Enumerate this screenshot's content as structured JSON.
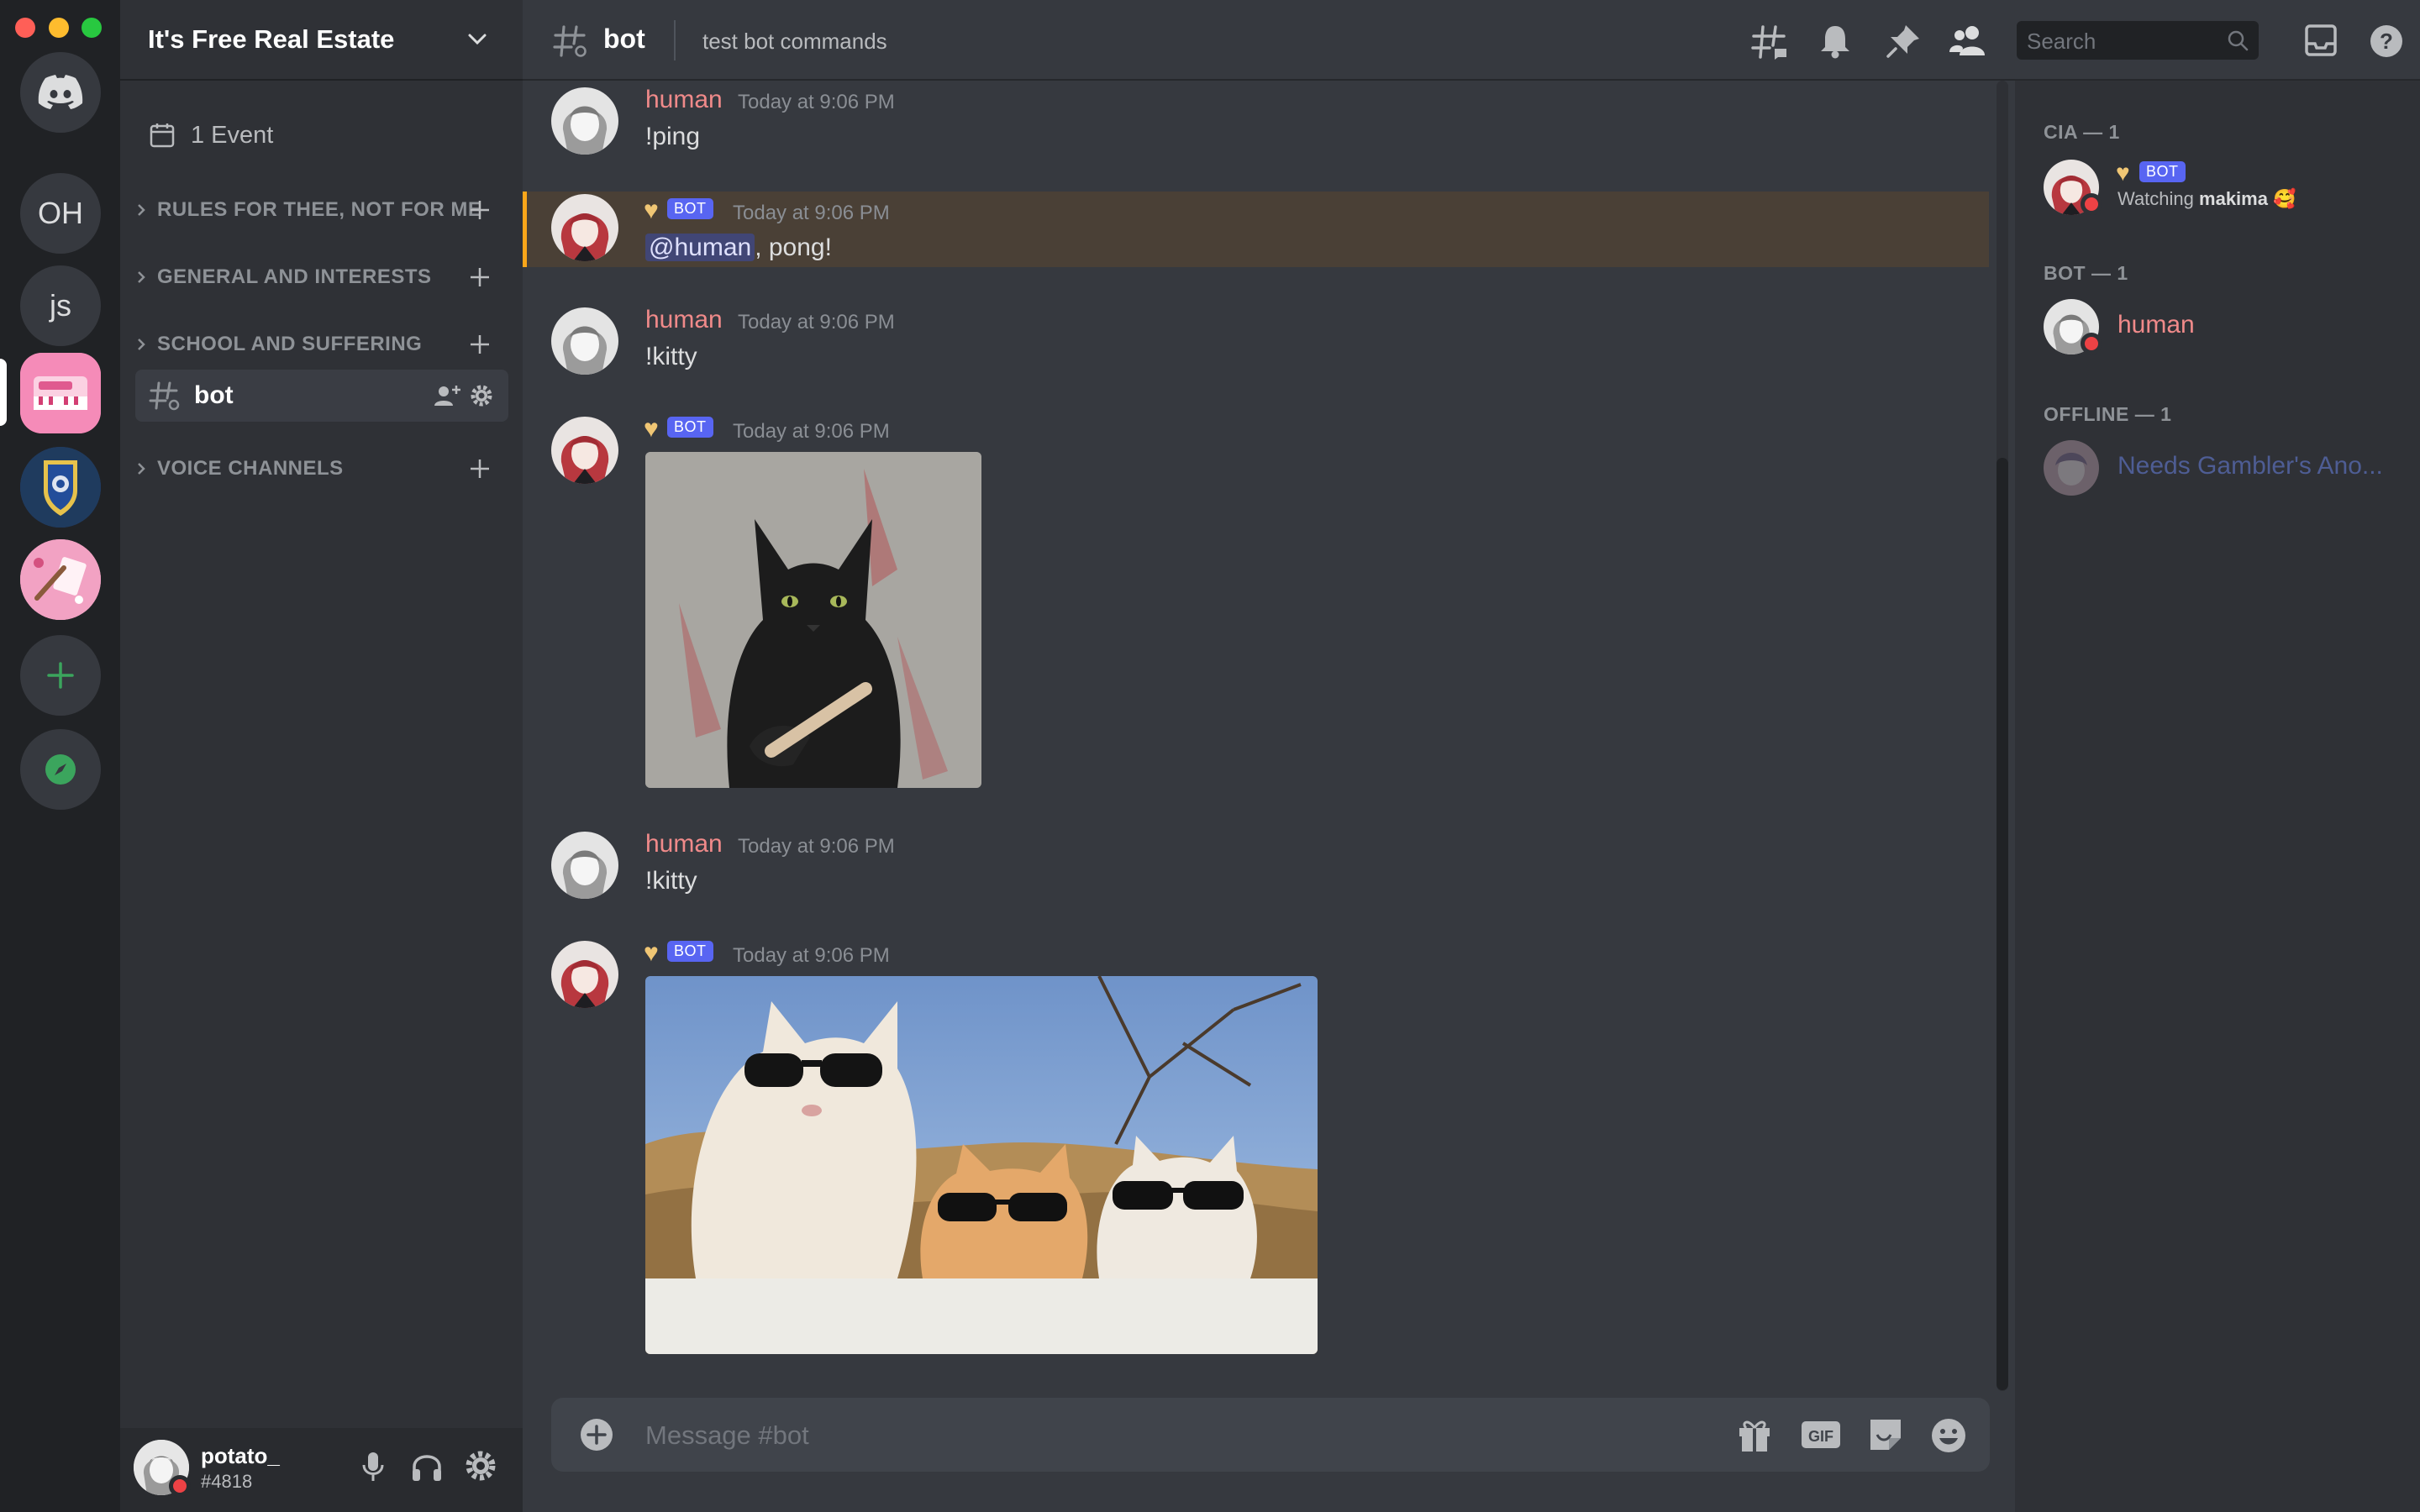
{
  "app": {
    "server_initials": [
      "OH",
      "js"
    ]
  },
  "sidebar": {
    "guild_name": "It's Free Real Estate",
    "events_label": "1 Event",
    "categories": [
      "RULES FOR THEE, NOT FOR ME",
      "GENERAL AND INTERESTS",
      "SCHOOL AND SUFFERING",
      "VOICE CHANNELS"
    ],
    "active_channel": "bot"
  },
  "user_panel": {
    "username": "potato_",
    "tag": "#4818"
  },
  "header": {
    "channel_name": "bot",
    "topic": "test bot commands",
    "search_placeholder": "Search"
  },
  "messages": [
    {
      "author": "human",
      "timestamp": "Today at 9:06 PM",
      "content": "!ping"
    },
    {
      "author": "",
      "bot_badge": "BOT",
      "timestamp": "Today at 9:06 PM",
      "mention": "@human",
      "content": ", pong!"
    },
    {
      "author": "human",
      "timestamp": "Today at 9:06 PM",
      "content": "!kitty"
    },
    {
      "author": "",
      "bot_badge": "BOT",
      "timestamp": "Today at 9:06 PM",
      "content": ""
    },
    {
      "author": "human",
      "timestamp": "Today at 9:06 PM",
      "content": "!kitty"
    },
    {
      "author": "",
      "bot_badge": "BOT",
      "timestamp": "Today at 9:06 PM",
      "content": ""
    }
  ],
  "bot_heart": "♥",
  "composer": {
    "placeholder": "Message #bot",
    "gif_label": "GIF"
  },
  "members": {
    "groups": [
      {
        "label": "CIA — 1"
      },
      {
        "label": "BOT — 1"
      },
      {
        "label": "OFFLINE — 1"
      }
    ],
    "bot_member": {
      "badge": "BOT",
      "activity_prefix": "Watching ",
      "activity_name": "makima",
      "activity_emoji": "🥰"
    },
    "human_member": {
      "name": "human"
    },
    "offline_member": {
      "name": "Needs Gambler's Ano..."
    }
  },
  "colors": {
    "accent": "#5865f2",
    "mention_highlight": "#faa61a",
    "username_red": "#f08a8a",
    "dnd_status": "#ed4245",
    "add_green": "#3ba55d"
  }
}
